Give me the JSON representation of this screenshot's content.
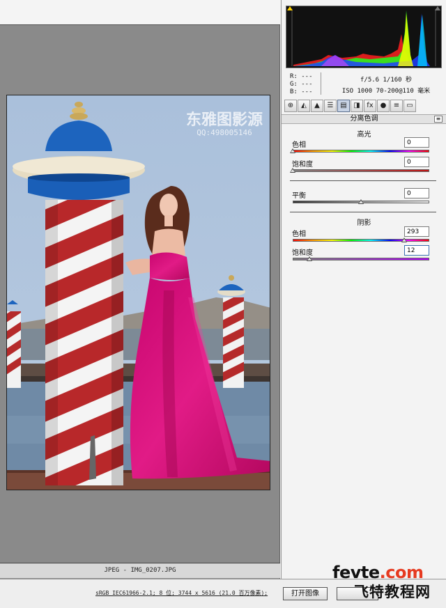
{
  "histogram_readout": {
    "r": "R:  ---",
    "g": "G:  ---",
    "b": "B:  ---",
    "aperture_shutter": "f/5.6  1/160 秒",
    "iso_lens": "ISO 1000  70-200@110 毫米"
  },
  "tool_tabs": [
    "⊕",
    "◭",
    "▲",
    "☰",
    "▤",
    "◨",
    "fx",
    "●",
    "≡",
    "▭"
  ],
  "panel": {
    "title": "分离色调",
    "menu_icon": "≡"
  },
  "highlights": {
    "title": "高光",
    "hue_label": "色相",
    "hue_value": "0",
    "hue_fraction": 0.0,
    "saturation_label": "饱和度",
    "saturation_value": "0",
    "saturation_fraction": 0.0
  },
  "balance": {
    "label": "平衡",
    "value": "0",
    "fraction": 0.5
  },
  "shadows": {
    "title": "阴影",
    "hue_label": "色相",
    "hue_value": "293",
    "hue_fraction": 0.814,
    "saturation_label": "饱和度",
    "saturation_value": "12",
    "saturation_fraction": 0.12
  },
  "photo": {
    "watermark": "东雅图影源",
    "watermark_sub": "QQ:498005146"
  },
  "filename_bar": "JPEG -  IMG_0207.JPG",
  "bottom_bar": {
    "image_info": "sRGB IEC61966-2.1; 8 位; 3744 x 5616 (21.0 百万像素);",
    "open_button": "打开图像"
  },
  "site_watermark": {
    "site_main": "fevte",
    "site_suffix": ".com",
    "site_cn": "飞特教程网"
  },
  "colors": {
    "dress": "#d0137a",
    "sky": "#a9c2da",
    "pole_blue": "#1a5fb8"
  }
}
